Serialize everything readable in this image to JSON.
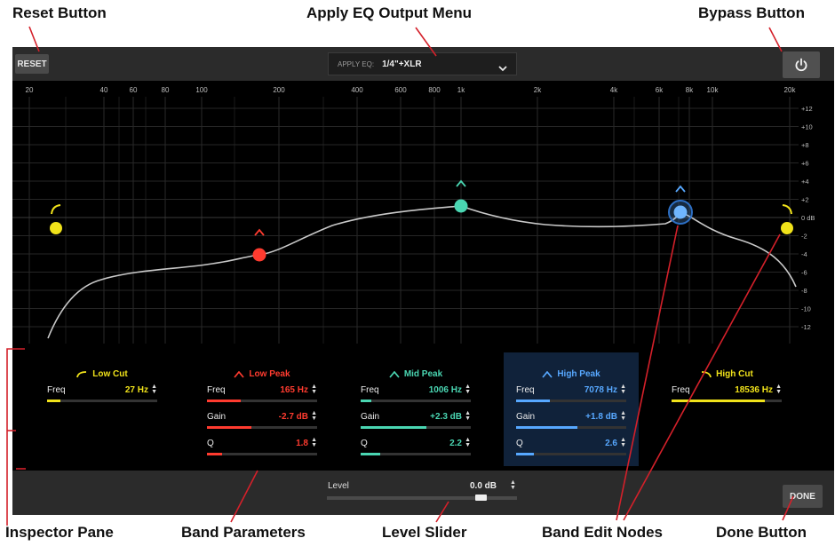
{
  "callouts": {
    "reset": "Reset Button",
    "apply_menu": "Apply EQ Output Menu",
    "bypass": "Bypass Button",
    "inspector": "Inspector Pane",
    "band_params": "Band Parameters",
    "level_slider": "Level Slider",
    "edit_nodes": "Band Edit Nodes",
    "done": "Done Button"
  },
  "toolbar": {
    "reset_label": "RESET",
    "apply_label": "APPLY EQ:",
    "apply_value": "1/4\"+XLR",
    "bypass_icon": "power-icon"
  },
  "graph": {
    "freq_ticks": [
      "20",
      "40",
      "60",
      "80",
      "100",
      "200",
      "400",
      "600",
      "800",
      "1k",
      "2k",
      "4k",
      "6k",
      "8k",
      "10k",
      "20k"
    ],
    "db_ticks": [
      "+12",
      "+10",
      "+8",
      "+6",
      "+4",
      "+2",
      "0 dB",
      "-2",
      "-4",
      "-6",
      "-8",
      "-10",
      "-12"
    ]
  },
  "bands": [
    {
      "name": "Low Cut",
      "color": "#f0e21a",
      "icon": "low-cut-icon",
      "params": [
        {
          "label": "Freq",
          "value": "27 Hz",
          "fill": 0.12
        }
      ]
    },
    {
      "name": "Low Peak",
      "color": "#ff3b2f",
      "icon": "peak-icon",
      "params": [
        {
          "label": "Freq",
          "value": "165 Hz",
          "fill": 0.31
        },
        {
          "label": "Gain",
          "value": "-2.7 dB",
          "fill": 0.4
        },
        {
          "label": "Q",
          "value": "1.8",
          "fill": 0.14
        }
      ]
    },
    {
      "name": "Mid Peak",
      "color": "#4ad6b2",
      "icon": "peak-icon",
      "params": [
        {
          "label": "Freq",
          "value": "1006 Hz",
          "fill": 0.1
        },
        {
          "label": "Gain",
          "value": "+2.3 dB",
          "fill": 0.6
        },
        {
          "label": "Q",
          "value": "2.2",
          "fill": 0.18
        }
      ]
    },
    {
      "name": "High Peak",
      "color": "#57a8ff",
      "icon": "peak-icon",
      "selected": true,
      "params": [
        {
          "label": "Freq",
          "value": "7078 Hz",
          "fill": 0.31
        },
        {
          "label": "Gain",
          "value": "+1.8 dB",
          "fill": 0.56
        },
        {
          "label": "Q",
          "value": "2.6",
          "fill": 0.16
        }
      ]
    },
    {
      "name": "High Cut",
      "color": "#f0e21a",
      "icon": "high-cut-icon",
      "params": [
        {
          "label": "Freq",
          "value": "18536 Hz",
          "fill": 0.85
        }
      ]
    }
  ],
  "level": {
    "label": "Level",
    "value": "0.0 dB",
    "position": 0.8
  },
  "done_label": "DONE"
}
